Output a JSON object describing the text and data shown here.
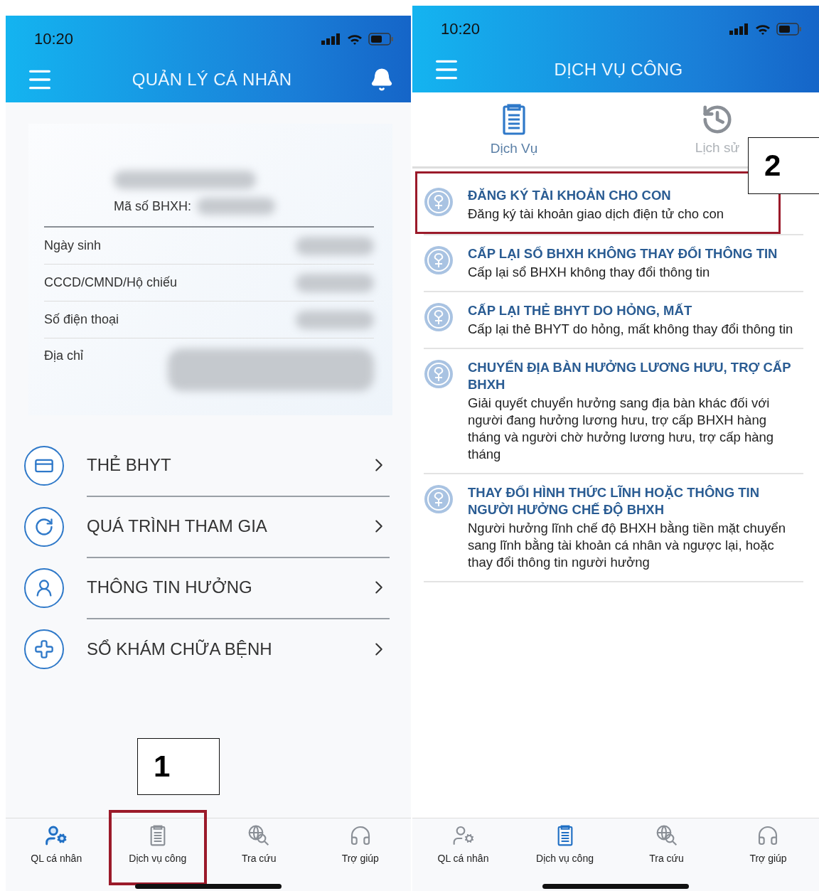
{
  "screens": [
    {
      "kind": "profile",
      "status_time": "10:20",
      "title": "QUẢN LÝ CÁ NHÂN",
      "profile": {
        "bhxh_label": "Mã số BHXH:",
        "fields": [
          {
            "label": "Ngày sinh"
          },
          {
            "label": "CCCD/CMND/Hộ chiếu"
          },
          {
            "label": "Số điện thoại"
          },
          {
            "label": "Địa chỉ"
          }
        ]
      },
      "menu": [
        {
          "kind": "card",
          "label": "THẺ BHYT"
        },
        {
          "kind": "history",
          "label": "QUÁ TRÌNH THAM GIA"
        },
        {
          "kind": "person",
          "label": "THÔNG TIN HƯỞNG"
        },
        {
          "kind": "medical",
          "label": "SỔ KHÁM CHỮA BỆNH"
        }
      ],
      "callout": "1",
      "nav": [
        {
          "kind": "profile",
          "label": "QL cá nhân",
          "selected": true,
          "highlighted": false
        },
        {
          "kind": "services",
          "label": "Dịch vụ công",
          "selected": false,
          "highlighted": true
        },
        {
          "kind": "lookup",
          "label": "Tra cứu",
          "selected": false,
          "highlighted": false
        },
        {
          "kind": "help",
          "label": "Trợ giúp",
          "selected": false,
          "highlighted": false
        }
      ]
    },
    {
      "kind": "services",
      "status_time": "10:20",
      "title": "DỊCH VỤ CÔNG",
      "tabs": [
        {
          "kind": "services",
          "label": "Dịch Vụ",
          "selected": true
        },
        {
          "kind": "history",
          "label": "Lịch sử",
          "selected": false
        }
      ],
      "callout": "2",
      "services": [
        {
          "title": "ĐĂNG KÝ TÀI KHOẢN CHO CON",
          "description": "Đăng ký tài khoản giao dịch điện tử cho con",
          "highlighted": true
        },
        {
          "title": "CẤP LẠI SỔ BHXH KHÔNG THAY ĐỔI THÔNG TIN",
          "description": "Cấp lại sổ BHXH không thay đổi thông tin",
          "highlighted": false
        },
        {
          "title": "CẤP LẠI THẺ BHYT DO HỎNG, MẤT",
          "description": "Cấp lại thẻ BHYT do hỏng, mất không thay đổi thông tin",
          "highlighted": false
        },
        {
          "title": "CHUYỂN ĐỊA BÀN HƯỞNG LƯƠNG HƯU, TRỢ CẤP BHXH",
          "description": "Giải quyết chuyển hưởng sang địa bàn khác đối với người đang hưởng lương hưu, trợ cấp BHXH hàng tháng và người chờ hưởng lương hưu, trợ cấp hàng tháng",
          "highlighted": false
        },
        {
          "title": "THAY ĐỔI HÌNH THỨC LĨNH HOẶC THÔNG TIN NGƯỜI HƯỞNG CHẾ ĐỘ BHXH",
          "description": "Người hưởng lĩnh chế độ BHXH bằng tiền mặt chuyển sang lĩnh bằng tài khoản cá nhân và ngược lại, hoặc thay đổi thông tin người hưởng",
          "highlighted": false
        }
      ],
      "nav": [
        {
          "kind": "profile",
          "label": "QL cá nhân",
          "selected": false,
          "highlighted": false
        },
        {
          "kind": "services",
          "label": "Dịch vụ công",
          "selected": true,
          "highlighted": false
        },
        {
          "kind": "lookup",
          "label": "Tra cứu",
          "selected": false,
          "highlighted": false
        },
        {
          "kind": "help",
          "label": "Trợ giúp",
          "selected": false,
          "highlighted": false
        }
      ]
    }
  ]
}
